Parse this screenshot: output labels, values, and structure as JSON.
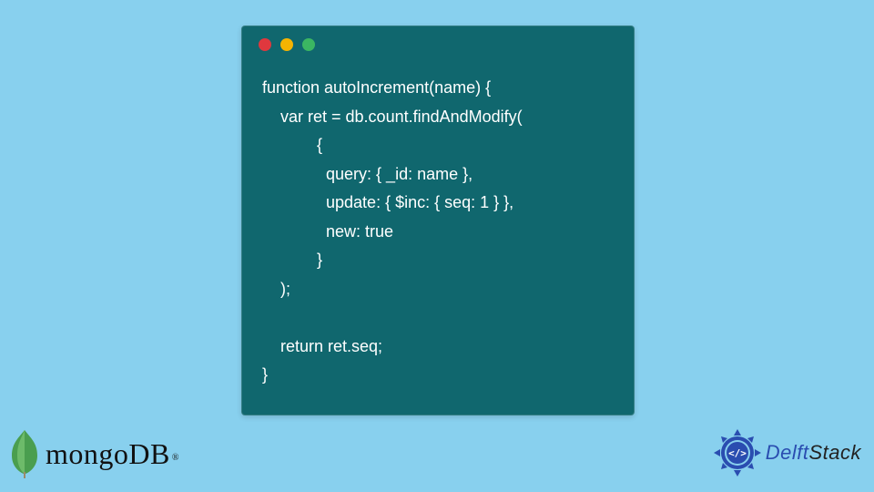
{
  "code": {
    "lines": [
      "function autoIncrement(name) {",
      "    var ret = db.count.findAndModify(",
      "            {",
      "              query: { _id: name },",
      "              update: { $inc: { seq: 1 } },",
      "              new: true",
      "            }",
      "    );",
      "",
      "    return ret.seq;",
      "}"
    ]
  },
  "window": {
    "dots": [
      "red",
      "yellow",
      "green"
    ]
  },
  "logos": {
    "mongo": {
      "text": "mongoDB",
      "registered": "®"
    },
    "delft": {
      "part1": "Delft",
      "part2": "Stack"
    }
  }
}
